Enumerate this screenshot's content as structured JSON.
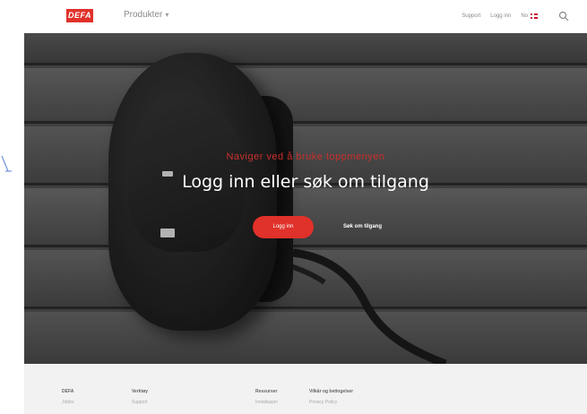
{
  "header": {
    "logo_text": "DEFA",
    "products_label": "Produkter",
    "support_label": "Support",
    "login_label": "Logg inn",
    "language_label": "No"
  },
  "hero": {
    "eyebrow": "Naviger ved å bruke toppmenyen",
    "title": "Logg inn eller søk om tilgang",
    "login_button": "Logg inn",
    "request_access_link": "Søk om tilgang"
  },
  "footer": {
    "columns": [
      {
        "heading": "DEFA",
        "item": "Jobbe"
      },
      {
        "heading": "Verktøy",
        "item": "Support"
      },
      {
        "heading": "Ressurser",
        "item": "Installasjon"
      },
      {
        "heading": "Vilkår og betingelser",
        "item": "Privacy Policy"
      }
    ]
  },
  "colors": {
    "accent": "#e0312a",
    "eyebrow": "#c9302c",
    "footer_bg": "#f2f2f2"
  }
}
